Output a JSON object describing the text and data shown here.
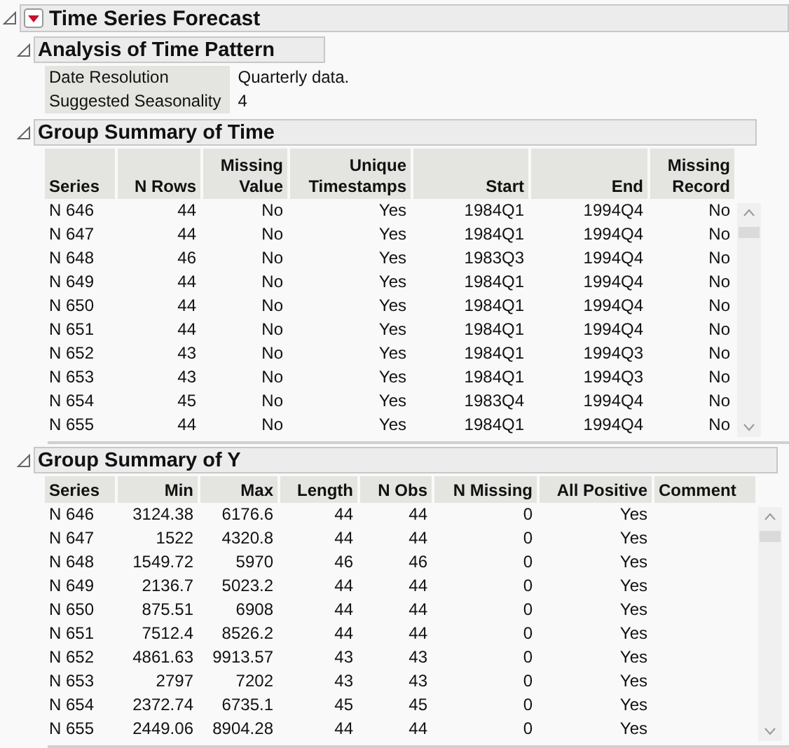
{
  "report": {
    "title": "Time Series Forecast",
    "expanded": true
  },
  "analysis": {
    "title": "Analysis of Time Pattern",
    "expanded": true,
    "rows": [
      {
        "label": "Date Resolution",
        "value": "Quarterly data."
      },
      {
        "label": "Suggested Seasonality",
        "value": "4"
      }
    ]
  },
  "tables": [
    {
      "title": "Group Summary of Time",
      "expanded": true,
      "columns": [
        "Series",
        "N Rows",
        "Missing\nValue",
        "Unique\nTimestamps",
        "Start",
        "End",
        "Missing\nRecord"
      ],
      "rows": [
        [
          "N 646",
          "44",
          "No",
          "Yes",
          "1984Q1",
          "1994Q4",
          "No"
        ],
        [
          "N 647",
          "44",
          "No",
          "Yes",
          "1984Q1",
          "1994Q4",
          "No"
        ],
        [
          "N 648",
          "46",
          "No",
          "Yes",
          "1983Q3",
          "1994Q4",
          "No"
        ],
        [
          "N 649",
          "44",
          "No",
          "Yes",
          "1984Q1",
          "1994Q4",
          "No"
        ],
        [
          "N 650",
          "44",
          "No",
          "Yes",
          "1984Q1",
          "1994Q4",
          "No"
        ],
        [
          "N 651",
          "44",
          "No",
          "Yes",
          "1984Q1",
          "1994Q4",
          "No"
        ],
        [
          "N 652",
          "43",
          "No",
          "Yes",
          "1984Q1",
          "1994Q3",
          "No"
        ],
        [
          "N 653",
          "43",
          "No",
          "Yes",
          "1984Q1",
          "1994Q3",
          "No"
        ],
        [
          "N 654",
          "45",
          "No",
          "Yes",
          "1983Q4",
          "1994Q4",
          "No"
        ],
        [
          "N 655",
          "44",
          "No",
          "Yes",
          "1984Q1",
          "1994Q4",
          "No"
        ]
      ]
    },
    {
      "title": "Group Summary of Y",
      "expanded": true,
      "columns": [
        "Series",
        "Min",
        "Max",
        "Length",
        "N Obs",
        "N Missing",
        "All Positive",
        "Comment"
      ],
      "rows": [
        [
          "N 646",
          "3124.38",
          "6176.6",
          "44",
          "44",
          "0",
          "Yes"
        ],
        [
          "N 647",
          "1522",
          "4320.8",
          "44",
          "44",
          "0",
          "Yes"
        ],
        [
          "N 648",
          "1549.72",
          "5970",
          "46",
          "46",
          "0",
          "Yes"
        ],
        [
          "N 649",
          "2136.7",
          "5023.2",
          "44",
          "44",
          "0",
          "Yes"
        ],
        [
          "N 650",
          "875.51",
          "6908",
          "44",
          "44",
          "0",
          "Yes"
        ],
        [
          "N 651",
          "7512.4",
          "8526.2",
          "44",
          "44",
          "0",
          "Yes"
        ],
        [
          "N 652",
          "4861.63",
          "9913.57",
          "43",
          "43",
          "0",
          "Yes"
        ],
        [
          "N 653",
          "2797",
          "7202",
          "43",
          "43",
          "0",
          "Yes"
        ],
        [
          "N 654",
          "2372.74",
          "6735.1",
          "45",
          "45",
          "0",
          "Yes"
        ],
        [
          "N 655",
          "2449.06",
          "8904.28",
          "44",
          "44",
          "0",
          "Yes"
        ]
      ]
    }
  ]
}
